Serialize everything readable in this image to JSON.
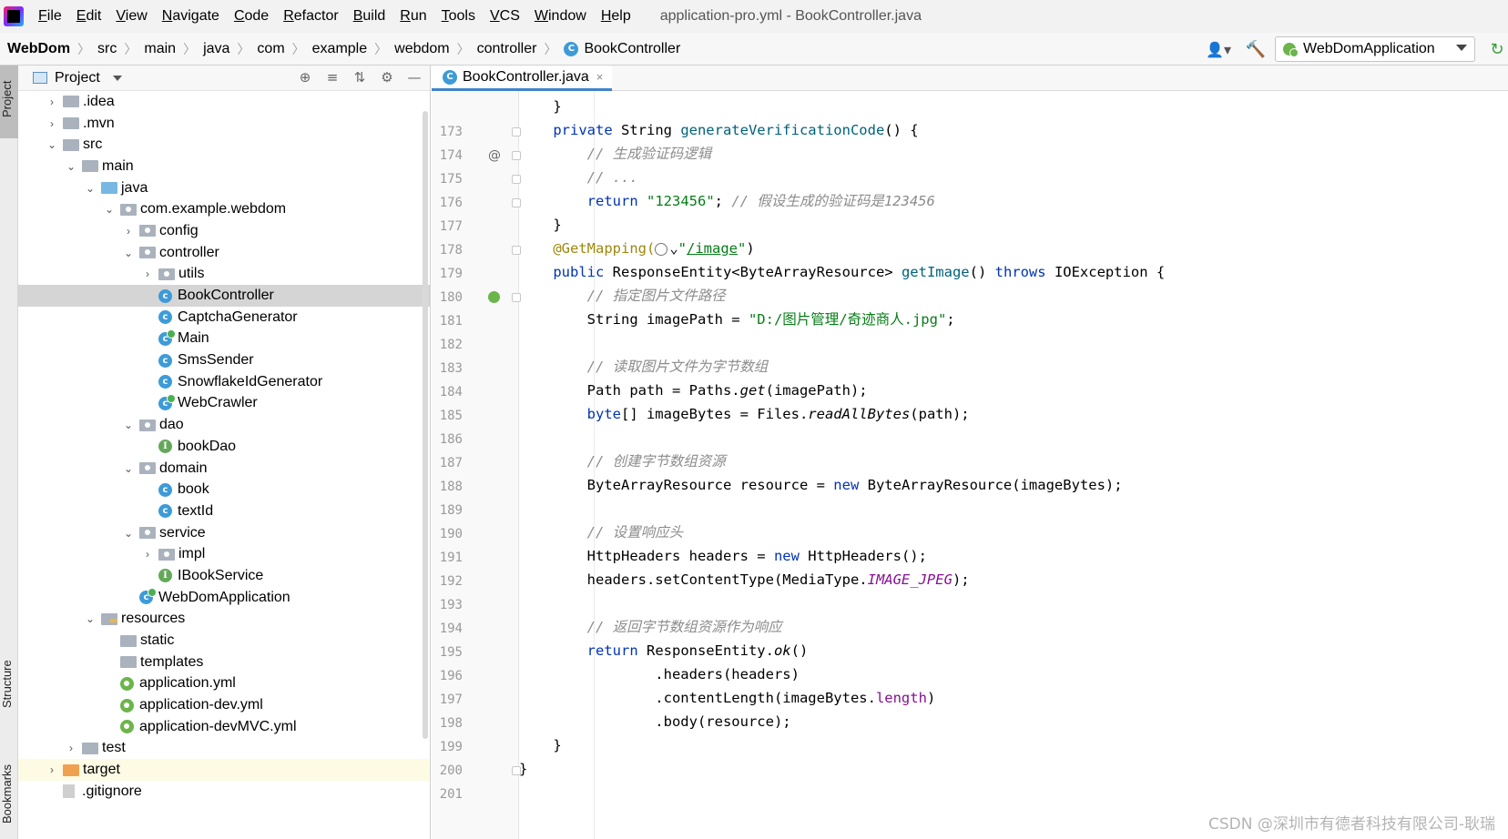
{
  "menubar": {
    "items": [
      {
        "label": "File",
        "mnemonic": "F",
        "rest": "ile"
      },
      {
        "label": "Edit",
        "mnemonic": "E",
        "rest": "dit"
      },
      {
        "label": "View",
        "mnemonic": "V",
        "rest": "iew"
      },
      {
        "label": "Navigate",
        "mnemonic": "N",
        "rest": "avigate"
      },
      {
        "label": "Code",
        "mnemonic": "C",
        "rest": "ode"
      },
      {
        "label": "Refactor",
        "mnemonic": "R",
        "rest": "efactor"
      },
      {
        "label": "Build",
        "mnemonic": "B",
        "rest": "uild"
      },
      {
        "label": "Run",
        "mnemonic": "R",
        "rest": "un"
      },
      {
        "label": "Tools",
        "mnemonic": "T",
        "rest": "ools"
      },
      {
        "label": "VCS",
        "mnemonic": "V",
        "rest": "CS"
      },
      {
        "label": "Window",
        "mnemonic": "W",
        "rest": "indow"
      },
      {
        "label": "Help",
        "mnemonic": "H",
        "rest": "elp"
      }
    ],
    "window_title": "application-pro.yml - BookController.java"
  },
  "breadcrumb": {
    "project": "WebDom",
    "items": [
      "src",
      "main",
      "java",
      "com",
      "example",
      "webdom",
      "controller"
    ],
    "current": "BookController",
    "class_badge": "C"
  },
  "toolbar": {
    "run_config": "WebDomApplication",
    "user_icon": "👤▾",
    "build_icon": "🔨",
    "refresh_icon": "↻"
  },
  "stripe": {
    "project": "Project",
    "structure": "Structure",
    "bookmarks": "Bookmarks"
  },
  "project_panel": {
    "title": "Project",
    "tools": [
      "⊕",
      "≡",
      "⇅",
      "⚙",
      "—"
    ]
  },
  "tree": [
    {
      "label": ".idea",
      "arrow": "›",
      "icon": "folder"
    },
    {
      "label": ".mvn",
      "arrow": "›",
      "icon": "folder"
    },
    {
      "label": "src",
      "arrow": "⌄",
      "icon": "folder"
    },
    {
      "label": "main",
      "arrow": "⌄",
      "icon": "folder"
    },
    {
      "label": "java",
      "arrow": "⌄",
      "icon": "folder-blue"
    },
    {
      "label": "com.example.webdom",
      "arrow": "⌄",
      "icon": "package"
    },
    {
      "label": "config",
      "arrow": "›",
      "icon": "package"
    },
    {
      "label": "controller",
      "arrow": "⌄",
      "icon": "package"
    },
    {
      "label": "utils",
      "arrow": "›",
      "icon": "package"
    },
    {
      "label": "BookController",
      "arrow": "",
      "icon": "class",
      "selected": true
    },
    {
      "label": "CaptchaGenerator",
      "arrow": "",
      "icon": "class"
    },
    {
      "label": "Main",
      "arrow": "",
      "icon": "class-run"
    },
    {
      "label": "SmsSender",
      "arrow": "",
      "icon": "class"
    },
    {
      "label": "SnowflakeIdGenerator",
      "arrow": "",
      "icon": "class"
    },
    {
      "label": "WebCrawler",
      "arrow": "",
      "icon": "class-run"
    },
    {
      "label": "dao",
      "arrow": "⌄",
      "icon": "package"
    },
    {
      "label": "bookDao",
      "arrow": "",
      "icon": "interface"
    },
    {
      "label": "domain",
      "arrow": "⌄",
      "icon": "package"
    },
    {
      "label": "book",
      "arrow": "",
      "icon": "class"
    },
    {
      "label": "textId",
      "arrow": "",
      "icon": "class"
    },
    {
      "label": "service",
      "arrow": "⌄",
      "icon": "package"
    },
    {
      "label": "impl",
      "arrow": "›",
      "icon": "package"
    },
    {
      "label": "IBookService",
      "arrow": "",
      "icon": "interface"
    },
    {
      "label": "WebDomApplication",
      "arrow": "",
      "icon": "class-run"
    },
    {
      "label": "resources",
      "arrow": "⌄",
      "icon": "resources"
    },
    {
      "label": "static",
      "arrow": "",
      "icon": "folder"
    },
    {
      "label": "templates",
      "arrow": "",
      "icon": "folder"
    },
    {
      "label": "application.yml",
      "arrow": "",
      "icon": "yml"
    },
    {
      "label": "application-dev.yml",
      "arrow": "",
      "icon": "yml"
    },
    {
      "label": "application-devMVC.yml",
      "arrow": "",
      "icon": "yml"
    },
    {
      "label": "test",
      "arrow": "›",
      "icon": "folder"
    },
    {
      "label": "target",
      "arrow": "›",
      "icon": "folder-orange",
      "highlight": true
    },
    {
      "label": ".gitignore",
      "arrow": "",
      "icon": "file"
    }
  ],
  "editor": {
    "tab_label": "BookController.java",
    "tab_close": "×",
    "lines": [
      {
        "n": "173",
        "html": "    }"
      },
      {
        "n": "174",
        "html": "    <span class=\"kw\">private</span> String <span class=\"fn\">generateVerificationCode</span>() {"
      },
      {
        "n": "175",
        "html": "        <span class=\"cmt\">// 生成验证码逻辑</span>"
      },
      {
        "n": "176",
        "html": "        <span class=\"cmt\">// ...</span>"
      },
      {
        "n": "177",
        "html": "        <span class=\"kw\">return</span> <span class=\"str\">\"123456\"</span>; <span class=\"cmt\">// 假设生成的验证码是123456</span>"
      },
      {
        "n": "178",
        "html": "    }"
      },
      {
        "n": "179",
        "html": "    <span class=\"ann\">@GetMapping(</span><span class=\"globe\"></span>⌄<span class=\"str\">\"</span><span class=\"lnk\">/image</span><span class=\"str\">\"</span>)"
      },
      {
        "n": "180",
        "html": "    <span class=\"kw\">public</span> ResponseEntity&lt;ByteArrayResource&gt; <span class=\"fn\">getImage</span>() <span class=\"kw\">throws</span> IOException {"
      },
      {
        "n": "181",
        "html": "        <span class=\"cmt\">// 指定图片文件路径</span>"
      },
      {
        "n": "182",
        "html": "        String imagePath = <span class=\"str\">\"D:/图片管理/奇迹商人.jpg\"</span>;"
      },
      {
        "n": "183",
        "html": ""
      },
      {
        "n": "184",
        "html": "        <span class=\"cmt\">// 读取图片文件为字节数组</span>"
      },
      {
        "n": "185",
        "html": "        Path path = Paths.<span class=\"it\">get</span>(imagePath);"
      },
      {
        "n": "186",
        "html": "        <span class=\"kw\">byte</span>[] imageBytes = Files.<span class=\"it\">readAllBytes</span>(path);"
      },
      {
        "n": "187",
        "html": ""
      },
      {
        "n": "188",
        "html": "        <span class=\"cmt\">// 创建字节数组资源</span>"
      },
      {
        "n": "189",
        "html": "        ByteArrayResource resource = <span class=\"kw\">new</span> ByteArrayResource(imageBytes);"
      },
      {
        "n": "190",
        "html": ""
      },
      {
        "n": "191",
        "html": "        <span class=\"cmt\">// 设置响应头</span>"
      },
      {
        "n": "192",
        "html": "        HttpHeaders headers = <span class=\"kw\">new</span> HttpHeaders();"
      },
      {
        "n": "193",
        "html": "        headers.setContentType(MediaType.<span class=\"st\">IMAGE_JPEG</span>);"
      },
      {
        "n": "194",
        "html": ""
      },
      {
        "n": "195",
        "html": "        <span class=\"cmt\">// 返回字节数组资源作为响应</span>"
      },
      {
        "n": "196",
        "html": "        <span class=\"kw\">return</span> ResponseEntity.<span class=\"it\">ok</span>()"
      },
      {
        "n": "197",
        "html": "                .headers(headers)"
      },
      {
        "n": "198",
        "html": "                .contentLength(imageBytes.<span class=\"st\" style=\"font-style:normal\">length</span>)"
      },
      {
        "n": "199",
        "html": "                .body(resource);"
      },
      {
        "n": "200",
        "html": "    }"
      },
      {
        "n": "201",
        "html": "}"
      }
    ],
    "watermark": "CSDN @深圳市有德者科技有限公司-耿瑞"
  },
  "colors": {
    "keyword": "#0033b3",
    "string": "#067d17",
    "comment": "#8c8c8c",
    "annotation": "#9e880d",
    "selection": "#d5d5d5",
    "tab_underline": "#4083c9"
  }
}
